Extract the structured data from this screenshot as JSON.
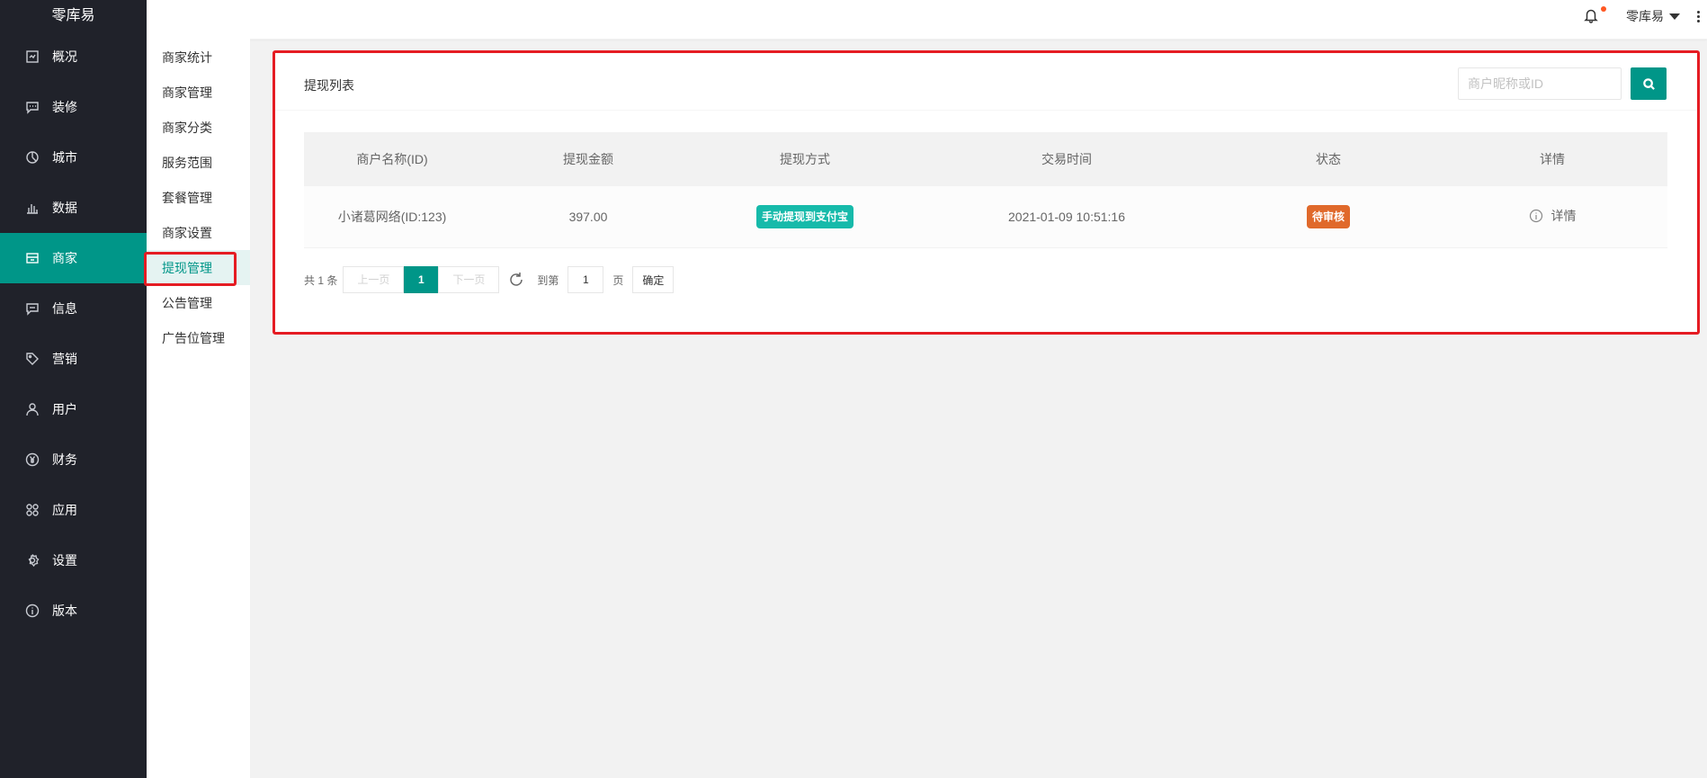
{
  "app": {
    "logo": "零库易"
  },
  "sidebar": {
    "items": [
      {
        "label": "概况",
        "icon": "dashboard-icon"
      },
      {
        "label": "装修",
        "icon": "chat-icon"
      },
      {
        "label": "城市",
        "icon": "chart-pie-icon"
      },
      {
        "label": "数据",
        "icon": "bar-chart-icon"
      },
      {
        "label": "商家",
        "icon": "store-icon",
        "active": true
      },
      {
        "label": "信息",
        "icon": "message-icon"
      },
      {
        "label": "营销",
        "icon": "tag-icon"
      },
      {
        "label": "用户",
        "icon": "user-icon"
      },
      {
        "label": "财务",
        "icon": "yen-icon"
      },
      {
        "label": "应用",
        "icon": "apps-icon"
      },
      {
        "label": "设置",
        "icon": "gear-icon"
      },
      {
        "label": "版本",
        "icon": "info-icon"
      }
    ]
  },
  "subnav": {
    "items": [
      {
        "label": "商家统计"
      },
      {
        "label": "商家管理"
      },
      {
        "label": "商家分类"
      },
      {
        "label": "服务范围"
      },
      {
        "label": "套餐管理"
      },
      {
        "label": "商家设置"
      },
      {
        "label": "提现管理",
        "active": true
      },
      {
        "label": "公告管理"
      },
      {
        "label": "广告位管理"
      }
    ]
  },
  "header": {
    "user_name": "零库易"
  },
  "card": {
    "title": "提现列表",
    "search_placeholder": "商户昵称或ID",
    "columns": [
      "商户名称(ID)",
      "提现金额",
      "提现方式",
      "交易时间",
      "状态",
      "详情"
    ],
    "rows": [
      {
        "merchant": "小诸葛网络(ID:123)",
        "amount": "397.00",
        "method": "手动提现到支付宝",
        "time": "2021-01-09 10:51:16",
        "status": "待审核",
        "detail": "详情"
      }
    ]
  },
  "pager": {
    "total": "共 1 条",
    "prev": "上一页",
    "current": "1",
    "next": "下一页",
    "goto_label": "到第",
    "goto_value": "1",
    "page_unit": "页",
    "confirm": "确定"
  },
  "colors": {
    "accent": "#009688",
    "sidebar_bg": "#20222a",
    "method_badge": "#16baaa",
    "status_badge": "#e0692b",
    "highlight": "#e51c23"
  }
}
